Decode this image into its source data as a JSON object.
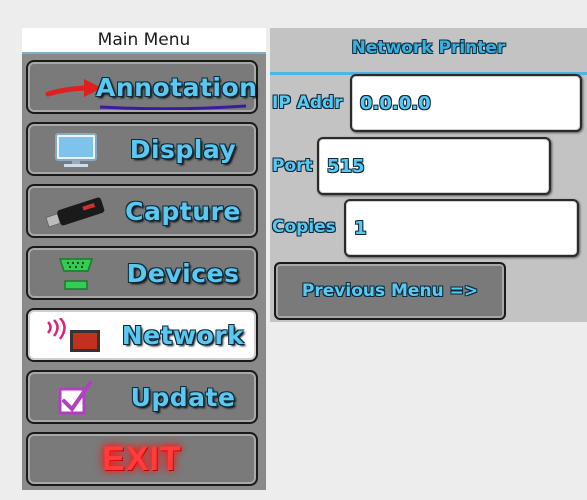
{
  "sidebar": {
    "title": "Main Menu",
    "items": [
      {
        "label": "Annotation",
        "icon": "red-arrow-icon"
      },
      {
        "label": "Display",
        "icon": "monitor-icon"
      },
      {
        "label": "Capture",
        "icon": "usb-stick-icon"
      },
      {
        "label": "Devices",
        "icon": "serial-port-icon"
      },
      {
        "label": "Network",
        "icon": "network-printer-icon",
        "active": true
      },
      {
        "label": "Update",
        "icon": "checkbox-icon"
      },
      {
        "label": "EXIT",
        "icon": ""
      }
    ]
  },
  "panel": {
    "title": "Network Printer",
    "ip_label": "IP Addr",
    "ip_value": "0.0.0.0",
    "port_label": "Port",
    "port_value": "515",
    "copies_label": "Copies",
    "copies_value": "1",
    "prev_label": "Previous Menu =>"
  },
  "colors": {
    "accent": "#5ac8f0",
    "exit": "#ff3b3b",
    "panel_bg": "#c3c3c3",
    "sidebar_bg": "#8a8a8a"
  }
}
